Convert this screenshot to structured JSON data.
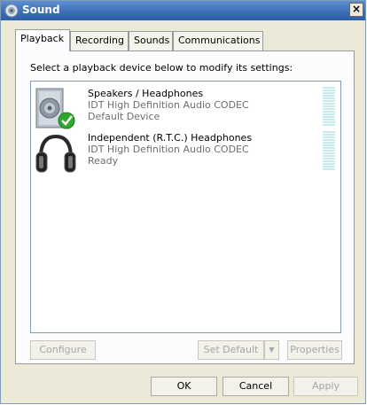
{
  "window": {
    "title": "Sound",
    "close_glyph": "×"
  },
  "tabs": [
    {
      "label": "Playback",
      "active": true
    },
    {
      "label": "Recording",
      "active": false
    },
    {
      "label": "Sounds",
      "active": false
    },
    {
      "label": "Communications",
      "active": false
    }
  ],
  "playback": {
    "instruction": "Select a playback device below to modify its settings:",
    "devices": [
      {
        "name": "Speakers / Headphones",
        "driver": "IDT High Definition Audio CODEC",
        "status": "Default Device",
        "icon": "speaker-icon",
        "is_default": true
      },
      {
        "name": "Independent (R.T.C.) Headphones",
        "driver": "IDT High Definition Audio CODEC",
        "status": "Ready",
        "icon": "headphones-icon",
        "is_default": false
      }
    ],
    "buttons": {
      "configure": "Configure",
      "set_default": "Set Default",
      "set_default_dropdown": "▼",
      "properties": "Properties"
    }
  },
  "dialog_buttons": {
    "ok": "OK",
    "cancel": "Cancel",
    "apply": "Apply"
  },
  "colors": {
    "titlebar": "#3d6fb8",
    "dialog_bg": "#ece9d8",
    "panel_bg": "#fcfcfe",
    "secondary_text": "#6d6d6d",
    "disabled_text": "#a6a6a6",
    "level_meter": "#c6ecef",
    "default_check": "#2ea82e"
  }
}
